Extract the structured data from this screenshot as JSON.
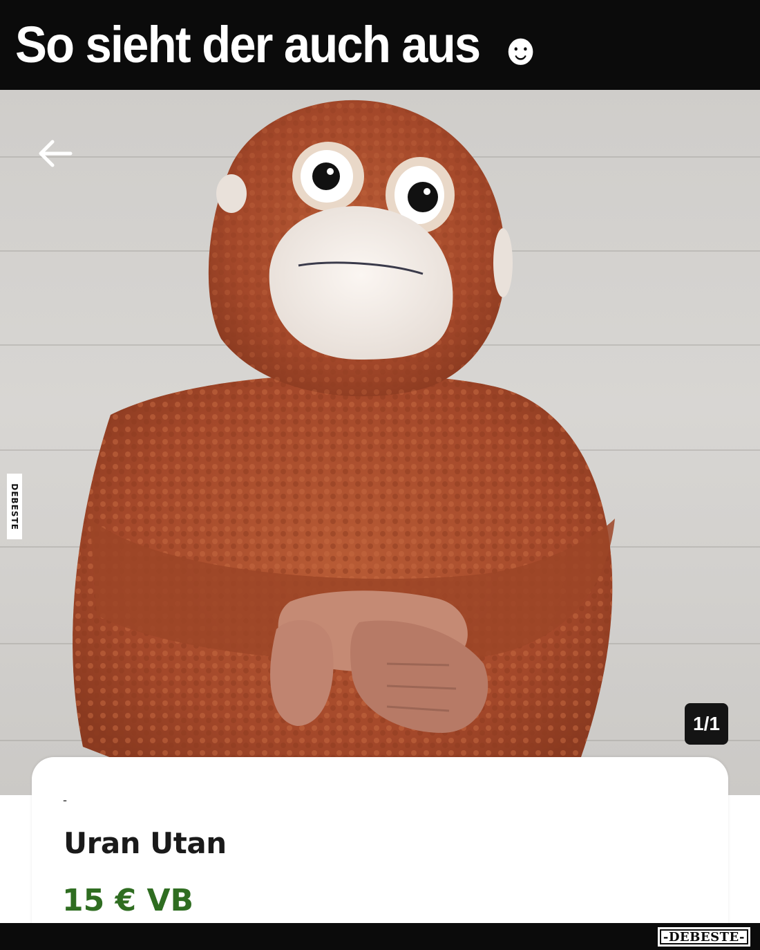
{
  "caption": {
    "text": "So sieht der auch aus",
    "emoji": "☻"
  },
  "photo": {
    "back_icon": "arrow-left-icon",
    "counter": "1/1",
    "side_watermark": "DEBESTE"
  },
  "listing": {
    "dash": "-",
    "title": "Uran Utan",
    "price": "15 € VB",
    "price_color": "#2f6d21"
  },
  "footer": {
    "watermark": "-DEBESTE-"
  }
}
